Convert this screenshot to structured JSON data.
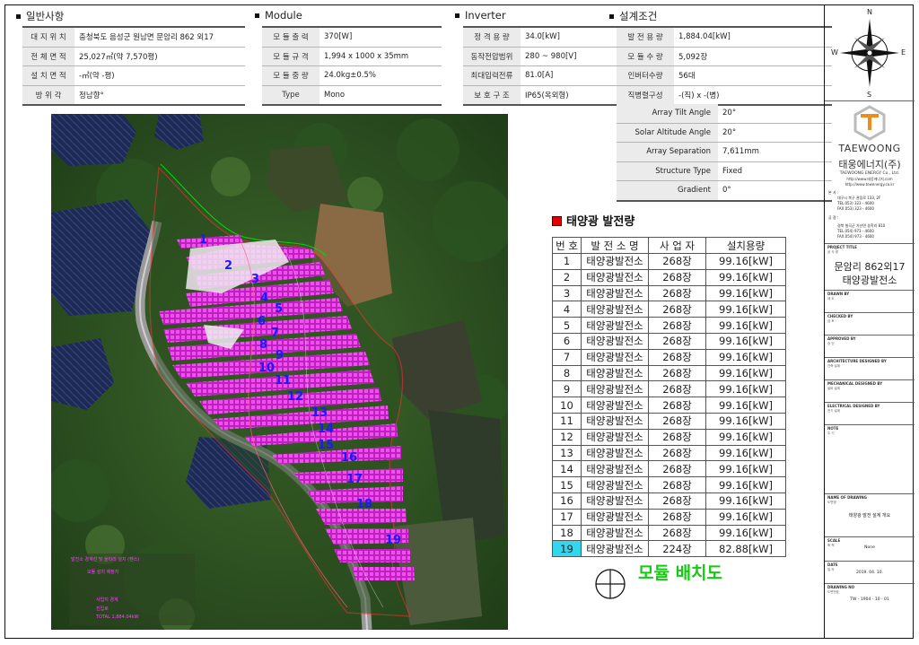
{
  "general": {
    "title": "일반사항",
    "rows": [
      {
        "k": "대 지 위 치",
        "v": "충청북도 음성군 원남면 문암리 862 외17"
      },
      {
        "k": "전 체 면 적",
        "v": "25,027㎡(약 7,570평)"
      },
      {
        "k": "설 치 면 적",
        "v": "-㎡(약 -평)"
      },
      {
        "k": "방   위   각",
        "v": "정남향°"
      }
    ]
  },
  "module": {
    "title": "Module",
    "rows": [
      {
        "k": "모 듈 출 력",
        "v": "370[W]"
      },
      {
        "k": "모 듈 규 격",
        "v": "1,994 x 1000 x 35mm"
      },
      {
        "k": "모 듈 중 량",
        "v": "24.0kg±0.5%"
      },
      {
        "k": "Type",
        "v": "Mono"
      }
    ]
  },
  "inverter": {
    "title": "Inverter",
    "rows": [
      {
        "k": "정 격 용 량",
        "v": "34.0[kW]"
      },
      {
        "k": "동작전압범위",
        "v": "280 ~ 980[V]"
      },
      {
        "k": "최대입력전류",
        "v": "81.0[A]"
      },
      {
        "k": "보 호 구 조",
        "v": "IP65(옥외형)"
      }
    ]
  },
  "design": {
    "title": "설계조건",
    "rows": [
      {
        "k": "발 전 용 량",
        "v": "1,884.04[kW]"
      },
      {
        "k": "모 듈 수 량",
        "v": "5,092장"
      },
      {
        "k": "인버터수량",
        "v": "56대"
      },
      {
        "k": "직병렬구성",
        "v": "-(직) x -(병)"
      }
    ],
    "array_rows": [
      {
        "k": "Array Tilt Angle",
        "v": "20°"
      },
      {
        "k": "Solar Altitude Angle",
        "v": "20°"
      },
      {
        "k": "Array Separation",
        "v": "7,611mm"
      },
      {
        "k": "Structure Type",
        "v": "Fixed"
      },
      {
        "k": "Gradient",
        "v": "0°"
      }
    ]
  },
  "compass": {
    "n": "N",
    "s": "S",
    "e": "E",
    "w": "W"
  },
  "power": {
    "title": "태양광 발전량",
    "headers": [
      "번 호",
      "발 전 소 명",
      "사 업 자",
      "설치용량"
    ],
    "rows": [
      {
        "no": "1",
        "name": "태양광발전소",
        "qty": "268장",
        "cap": "99.16[kW]"
      },
      {
        "no": "2",
        "name": "태양광발전소",
        "qty": "268장",
        "cap": "99.16[kW]"
      },
      {
        "no": "3",
        "name": "태양광발전소",
        "qty": "268장",
        "cap": "99.16[kW]"
      },
      {
        "no": "4",
        "name": "태양광발전소",
        "qty": "268장",
        "cap": "99.16[kW]"
      },
      {
        "no": "5",
        "name": "태양광발전소",
        "qty": "268장",
        "cap": "99.16[kW]"
      },
      {
        "no": "6",
        "name": "태양광발전소",
        "qty": "268장",
        "cap": "99.16[kW]"
      },
      {
        "no": "7",
        "name": "태양광발전소",
        "qty": "268장",
        "cap": "99.16[kW]"
      },
      {
        "no": "8",
        "name": "태양광발전소",
        "qty": "268장",
        "cap": "99.16[kW]"
      },
      {
        "no": "9",
        "name": "태양광발전소",
        "qty": "268장",
        "cap": "99.16[kW]"
      },
      {
        "no": "10",
        "name": "태양광발전소",
        "qty": "268장",
        "cap": "99.16[kW]"
      },
      {
        "no": "11",
        "name": "태양광발전소",
        "qty": "268장",
        "cap": "99.16[kW]"
      },
      {
        "no": "12",
        "name": "태양광발전소",
        "qty": "268장",
        "cap": "99.16[kW]"
      },
      {
        "no": "13",
        "name": "태양광발전소",
        "qty": "268장",
        "cap": "99.16[kW]"
      },
      {
        "no": "14",
        "name": "태양광발전소",
        "qty": "268장",
        "cap": "99.16[kW]"
      },
      {
        "no": "15",
        "name": "태양광발전소",
        "qty": "268장",
        "cap": "99.16[kW]"
      },
      {
        "no": "16",
        "name": "태양광발전소",
        "qty": "268장",
        "cap": "99.16[kW]"
      },
      {
        "no": "17",
        "name": "태양광발전소",
        "qty": "268장",
        "cap": "99.16[kW]"
      },
      {
        "no": "18",
        "name": "태양광발전소",
        "qty": "268장",
        "cap": "99.16[kW]"
      },
      {
        "no": "19",
        "name": "태양광발전소",
        "qty": "224장",
        "cap": "82.88[kW]"
      }
    ]
  },
  "layout_title": "모듈 배치도",
  "map_labels": [
    "1",
    "2",
    "3",
    "4",
    "5",
    "6",
    "7",
    "8",
    "9",
    "10",
    "11",
    "12",
    "13",
    "14",
    "15",
    "16",
    "17",
    "18",
    "19"
  ],
  "colors": {
    "module_fill": "#e000e0",
    "label_blue": "#1a1aff",
    "boundary_red": "#ff3030",
    "boundary_green": "#00dd00",
    "highlight_cyan": "#33d6ea",
    "layout_title_green": "#11cc11"
  },
  "titleblock": {
    "brand": "TAEWOONG",
    "brand_kr": "태웅에너지(주)",
    "brand_en": "TAEWOONG ENERGY Co., Ltd.",
    "url1": "http://www.태웅에너지.com",
    "url2": "http://www.tewenergy.co.kr",
    "office_label": "본 사 :",
    "office_addr": "대구시 북구 관음로 133, 2F",
    "office_tel": "TEL.053) 323 - 4600",
    "office_fax": "FAX.053) 323 - 4600",
    "branch_label": "공 장 :",
    "branch_addr": "경북 칠곡군 가산면 송학리 810",
    "branch_tel": "TEL.054) 973 - 4600",
    "branch_fax": "FAX.054) 973 - 4600",
    "project_label": "PROJECT TITLE",
    "project_sub": "공 사 명",
    "project_l1": "문암리 862외17",
    "project_l2": "태양광발전소",
    "drawn": "DRAWN BY",
    "drawn_sub": "제 도",
    "checked": "CHECKED BY",
    "checked_sub": "검 토",
    "approved": "APPROVED BY",
    "approved_sub": "승 인",
    "arch": "ARCHITECTURE DESIGNED BY",
    "arch_sub": "건축 설계",
    "mech": "MECHANICAL DESIGNED BY",
    "mech_sub": "설비 설계",
    "elec": "ELECTRICAL DESIGNED BY",
    "elec_sub": "전기 설계",
    "note": "NOTE",
    "note_sub": "주 기",
    "drawing_name": "NAME OF DRAWING",
    "drawing_name_sub": "도면명",
    "drawing_name_val": "태양광 발전 설계 개요",
    "scale": "SCALE",
    "scale_sub": "축 척",
    "scale_val": "None",
    "date": "DATE",
    "date_sub": "일 자",
    "date_val": "2019. 04. 10.",
    "drawing_no": "DRAWING NO",
    "drawing_no_sub": "도면번호",
    "drawing_no_val": "TW - 1904 - 10 - 01"
  },
  "legend": {
    "l1": "발전소 경계선 및 울타리 설치 (펜스)",
    "l2": "모듈 설치 예정지",
    "l3": "사업지 경계",
    "l4": "진입로",
    "l5": "TOTAL 1,884.04kW"
  }
}
